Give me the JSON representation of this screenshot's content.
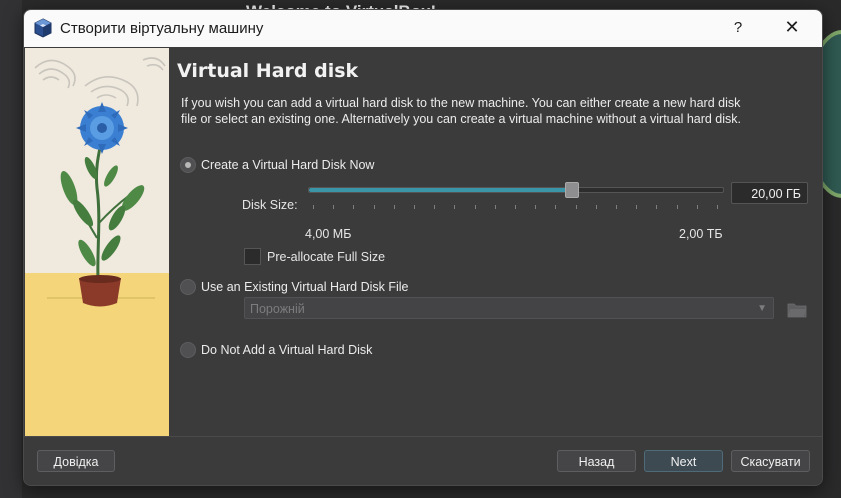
{
  "background": {
    "window_title": "Welcome to VirtualBox!"
  },
  "dialog": {
    "title": "Створити віртуальну машину",
    "help_label": "?",
    "close_label": "✕",
    "icon": "virtualbox-cube-icon"
  },
  "content": {
    "heading": "Virtual Hard disk",
    "description": "If you wish you can add a virtual hard disk to the new machine. You can either create a new hard disk file or select an existing one. Alternatively you can create a virtual machine without a virtual hard disk.",
    "options": {
      "create_new": {
        "label": "Create a Virtual Hard Disk Now",
        "checked": true
      },
      "use_existing": {
        "label": "Use an Existing Virtual Hard Disk File",
        "checked": false
      },
      "do_not_add": {
        "label": "Do Not Add a Virtual Hard Disk",
        "checked": false
      }
    },
    "disk_size": {
      "label": "Disk Size:",
      "value": "20,00 ГБ",
      "min_label": "4,00 МБ",
      "max_label": "2,00 ТБ",
      "slider_fraction": 0.635
    },
    "preallocate": {
      "label": "Pre-allocate Full Size",
      "checked": false
    },
    "existing_file": {
      "placeholder": "Порожній",
      "enabled": false
    }
  },
  "footer": {
    "help_button": "Довідка",
    "back_button": "Назад",
    "next_button": "Next",
    "cancel_button": "Скасувати"
  },
  "colors": {
    "accent": "#3a95a8",
    "titlebar": "#fafafa",
    "background": "#3b3b3c"
  }
}
